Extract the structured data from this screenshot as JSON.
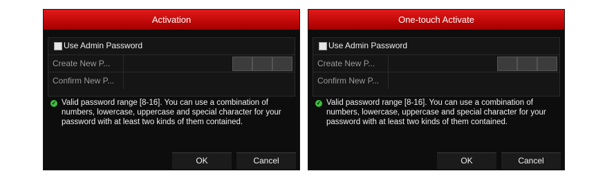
{
  "dialogs": [
    {
      "title": "Activation",
      "use_admin_label": "Use Admin Password",
      "create_label": "Create New P...",
      "confirm_label": "Confirm New P...",
      "hint": "Valid password range [8-16]. You can use a combination of numbers, lowercase, uppercase and special character for your password with at least two kinds of them contained.",
      "ok_label": "OK",
      "cancel_label": "Cancel"
    },
    {
      "title": "One-touch Activate",
      "use_admin_label": "Use Admin Password",
      "create_label": "Create New P...",
      "confirm_label": "Confirm New P...",
      "hint": "Valid password range [8-16]. You can use a combination of numbers, lowercase, uppercase and special character for your password with at least two kinds of them contained.",
      "ok_label": "OK",
      "cancel_label": "Cancel"
    }
  ],
  "colors": {
    "title_bar": "#c00808",
    "dialog_bg": "#0d0d0d",
    "hint_icon": "#3fbf3f"
  },
  "icons": {
    "hint": "check-circle-icon"
  }
}
